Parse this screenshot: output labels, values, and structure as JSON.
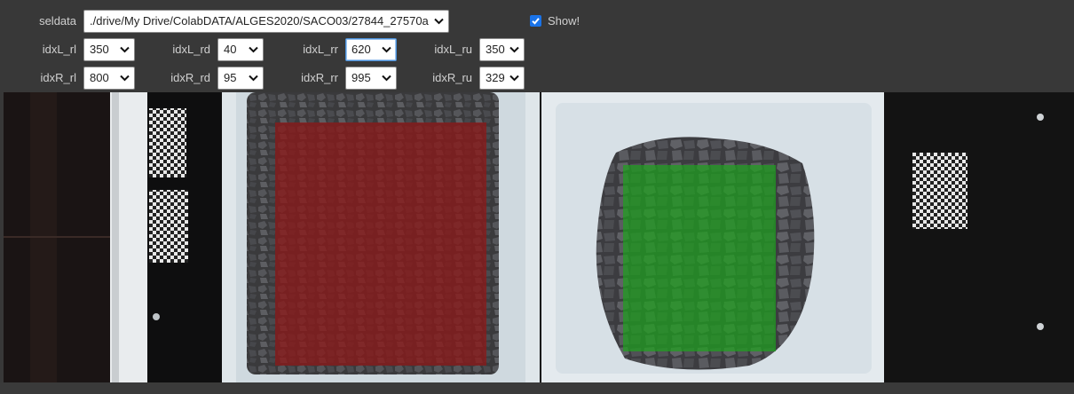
{
  "controls": {
    "seldata": {
      "label": "seldata",
      "value": "./drive/My Drive/ColabDATA/ALGES2020/SACO03/27844_27570a"
    },
    "show": {
      "label": "Show!",
      "checked": true
    },
    "row_left": [
      {
        "label": "idxL_rl",
        "value": "350"
      },
      {
        "label": "idxL_rd",
        "value": "40"
      },
      {
        "label": "idxL_rr",
        "value": "620"
      },
      {
        "label": "idxL_ru",
        "value": "350"
      }
    ],
    "row_right": [
      {
        "label": "idxR_rl",
        "value": "800"
      },
      {
        "label": "idxR_rd",
        "value": "95"
      },
      {
        "label": "idxR_rr",
        "value": "995"
      },
      {
        "label": "idxR_ru",
        "value": "329"
      }
    ]
  },
  "image": {
    "description_icon": "aggregate-sample-photo",
    "left_overlay_color": "#8b1a1a",
    "right_overlay_color": "#1fa11f"
  },
  "colors": {
    "background": "#383838",
    "checkbox": "#1a73e8",
    "focus": "#4a90d9"
  }
}
